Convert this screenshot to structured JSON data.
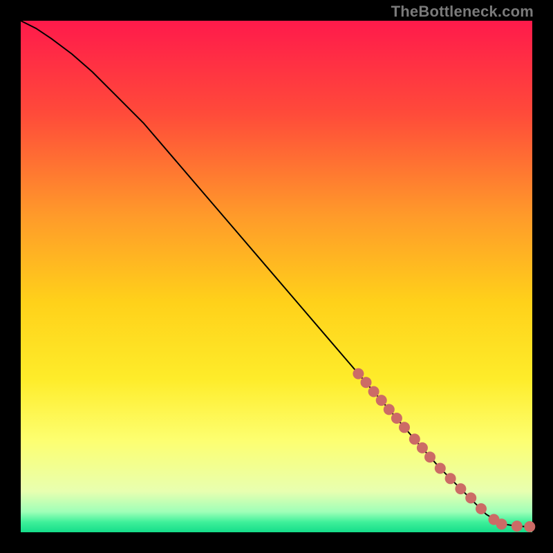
{
  "watermark": "TheBottleneck.com",
  "chart_data": {
    "type": "line",
    "title": "",
    "xlabel": "",
    "ylabel": "",
    "xlim": [
      0,
      100
    ],
    "ylim": [
      0,
      100
    ],
    "grid": false,
    "legend": false,
    "gradient_stops": [
      {
        "pct": 0,
        "color": "#ff1a4b"
      },
      {
        "pct": 18,
        "color": "#ff4a3a"
      },
      {
        "pct": 38,
        "color": "#ff9a2a"
      },
      {
        "pct": 55,
        "color": "#ffd11a"
      },
      {
        "pct": 70,
        "color": "#feec2a"
      },
      {
        "pct": 82,
        "color": "#fdff70"
      },
      {
        "pct": 92,
        "color": "#e8ffb0"
      },
      {
        "pct": 96,
        "color": "#9fffb8"
      },
      {
        "pct": 98,
        "color": "#3ff09a"
      },
      {
        "pct": 100,
        "color": "#15dd8a"
      }
    ],
    "series": [
      {
        "name": "curve",
        "style": "line",
        "color": "#000000",
        "x": [
          0,
          3,
          6,
          10,
          14,
          18,
          24,
          30,
          36,
          42,
          48,
          54,
          60,
          66,
          72,
          78,
          82,
          86,
          89,
          91,
          93,
          95,
          97,
          99,
          100
        ],
        "y": [
          100,
          98.5,
          96.5,
          93.5,
          90,
          86,
          80,
          73,
          66,
          59,
          52,
          45,
          38,
          31,
          24,
          17,
          12.5,
          8.5,
          5.5,
          3.5,
          2.3,
          1.5,
          1.2,
          1.1,
          1.1
        ]
      },
      {
        "name": "dotted-segment",
        "style": "markers",
        "color": "#cc6b66",
        "marker_radius": 8,
        "x": [
          66.0,
          67.5,
          69.0,
          70.5,
          72.0,
          73.5,
          75.0,
          77.0,
          78.5,
          80.0,
          82.0,
          84.0,
          86.0,
          88.0,
          90.0,
          92.5,
          94.0,
          97.0,
          99.5
        ],
        "y": [
          31.0,
          29.3,
          27.5,
          25.8,
          24.0,
          22.3,
          20.5,
          18.2,
          16.5,
          14.7,
          12.5,
          10.5,
          8.5,
          6.7,
          4.6,
          2.5,
          1.6,
          1.2,
          1.1
        ]
      }
    ]
  }
}
